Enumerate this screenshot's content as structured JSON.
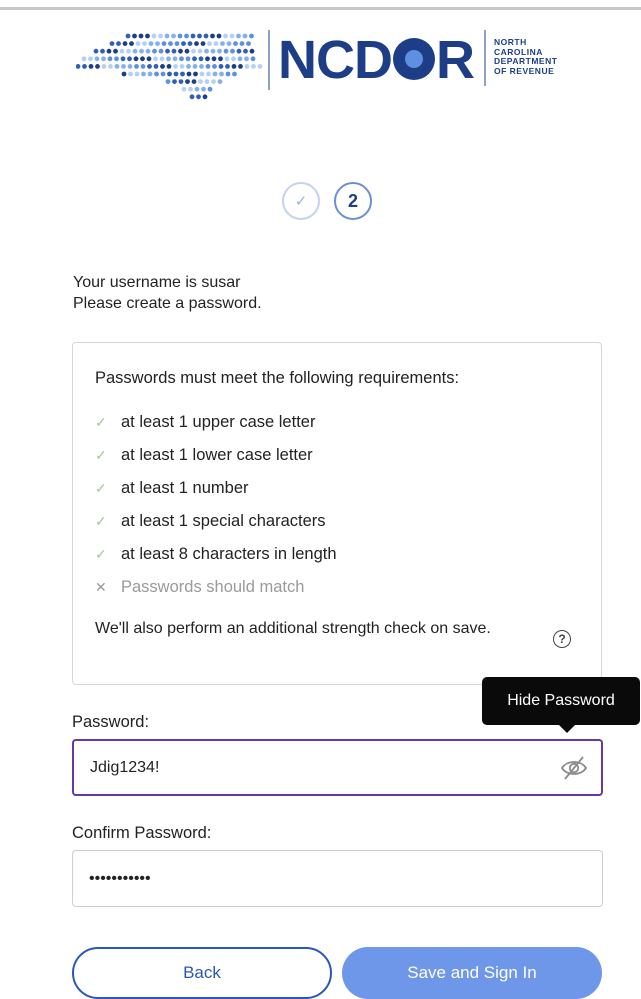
{
  "logo": {
    "name": "NCDOR",
    "subtitle": [
      "NORTH",
      "CAROLINA",
      "DEPARTMENT",
      "OF REVENUE"
    ]
  },
  "steps": [
    {
      "label": "✓",
      "state": "complete"
    },
    {
      "label": "2",
      "state": "current"
    }
  ],
  "intro": {
    "line1": "Your username is susar",
    "line2": "Please create a password."
  },
  "requirements": {
    "title": "Passwords must meet the following requirements:",
    "items": [
      {
        "text": "at least 1 upper case letter",
        "met": true
      },
      {
        "text": "at least 1 lower case letter",
        "met": true
      },
      {
        "text": "at least 1 number",
        "met": true
      },
      {
        "text": "at least 1 special characters",
        "met": true
      },
      {
        "text": "at least 8 characters in length",
        "met": true
      },
      {
        "text": "Passwords should match",
        "met": false
      }
    ],
    "note": "We'll also perform an additional strength check on save."
  },
  "password": {
    "label": "Password:",
    "value": "Jdig1234!",
    "tooltip": "Hide Password"
  },
  "confirm": {
    "label": "Confirm Password:",
    "value": "•••••••••••"
  },
  "buttons": {
    "back": "Back",
    "save": "Save and Sign In"
  },
  "colors": {
    "brand": "#1d3e86",
    "accent": "#6e97ea",
    "focus": "#6a35a8",
    "check": "#a8c59e"
  }
}
